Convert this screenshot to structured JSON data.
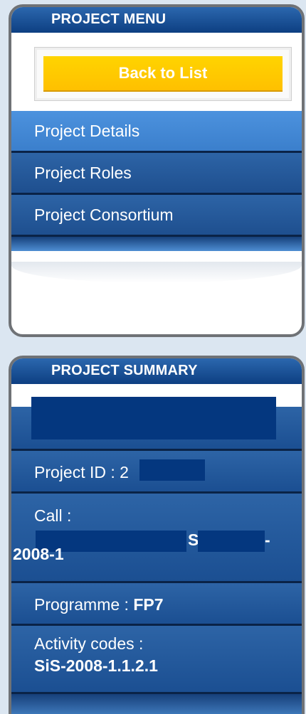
{
  "project_menu": {
    "header": "PROJECT MENU",
    "back_button": "Back to List",
    "items": [
      {
        "label": "Project Details",
        "active": true
      },
      {
        "label": "Project Roles",
        "active": false
      },
      {
        "label": "Project Consortium",
        "active": false
      }
    ]
  },
  "project_summary": {
    "header": "PROJECT SUMMARY",
    "project_id_label": "Project ID :",
    "project_id_fragment": "2",
    "call_label": "Call :",
    "call_fragment_s": "S",
    "call_fragment_dash": "-",
    "call_line2": "2008-1",
    "programme_label": "Programme :",
    "programme_value": "FP7",
    "activity_label": "Activity codes :",
    "activity_value": "SiS-2008-1.1.2.1"
  },
  "colors": {
    "header_blue": "#0d3f82",
    "menu_blue": "#2d64a6",
    "active_blue": "#4c92de",
    "button_yellow": "#ffc000",
    "redaction": "#04377f"
  }
}
